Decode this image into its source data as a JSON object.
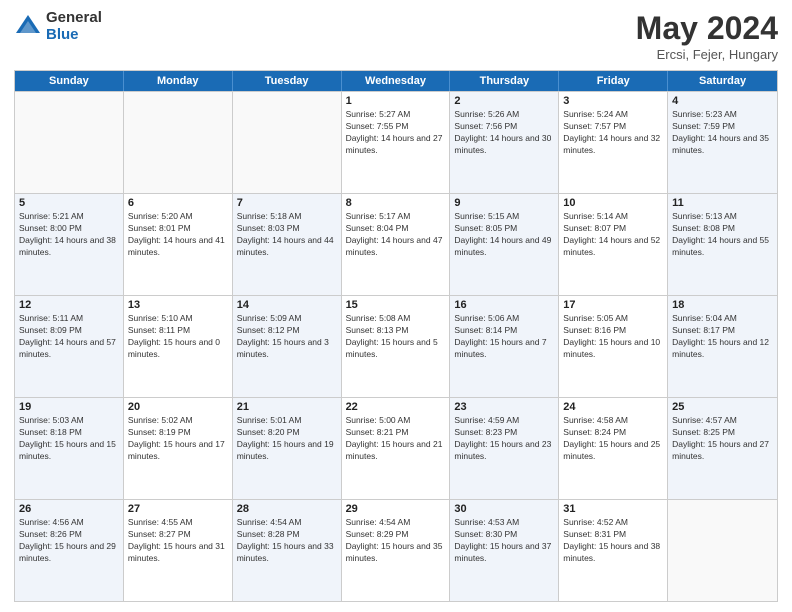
{
  "header": {
    "logo_general": "General",
    "logo_blue": "Blue",
    "title": "May 2024",
    "subtitle": "Ercsi, Fejer, Hungary"
  },
  "calendar": {
    "days_of_week": [
      "Sunday",
      "Monday",
      "Tuesday",
      "Wednesday",
      "Thursday",
      "Friday",
      "Saturday"
    ],
    "rows": [
      [
        {
          "day": "",
          "empty": true
        },
        {
          "day": "",
          "empty": true
        },
        {
          "day": "",
          "empty": true
        },
        {
          "day": "1",
          "sunrise": "5:27 AM",
          "sunset": "7:55 PM",
          "daylight": "14 hours and 27 minutes."
        },
        {
          "day": "2",
          "sunrise": "5:26 AM",
          "sunset": "7:56 PM",
          "daylight": "14 hours and 30 minutes."
        },
        {
          "day": "3",
          "sunrise": "5:24 AM",
          "sunset": "7:57 PM",
          "daylight": "14 hours and 32 minutes."
        },
        {
          "day": "4",
          "sunrise": "5:23 AM",
          "sunset": "7:59 PM",
          "daylight": "14 hours and 35 minutes."
        }
      ],
      [
        {
          "day": "5",
          "sunrise": "5:21 AM",
          "sunset": "8:00 PM",
          "daylight": "14 hours and 38 minutes."
        },
        {
          "day": "6",
          "sunrise": "5:20 AM",
          "sunset": "8:01 PM",
          "daylight": "14 hours and 41 minutes."
        },
        {
          "day": "7",
          "sunrise": "5:18 AM",
          "sunset": "8:03 PM",
          "daylight": "14 hours and 44 minutes."
        },
        {
          "day": "8",
          "sunrise": "5:17 AM",
          "sunset": "8:04 PM",
          "daylight": "14 hours and 47 minutes."
        },
        {
          "day": "9",
          "sunrise": "5:15 AM",
          "sunset": "8:05 PM",
          "daylight": "14 hours and 49 minutes."
        },
        {
          "day": "10",
          "sunrise": "5:14 AM",
          "sunset": "8:07 PM",
          "daylight": "14 hours and 52 minutes."
        },
        {
          "day": "11",
          "sunrise": "5:13 AM",
          "sunset": "8:08 PM",
          "daylight": "14 hours and 55 minutes."
        }
      ],
      [
        {
          "day": "12",
          "sunrise": "5:11 AM",
          "sunset": "8:09 PM",
          "daylight": "14 hours and 57 minutes."
        },
        {
          "day": "13",
          "sunrise": "5:10 AM",
          "sunset": "8:11 PM",
          "daylight": "15 hours and 0 minutes."
        },
        {
          "day": "14",
          "sunrise": "5:09 AM",
          "sunset": "8:12 PM",
          "daylight": "15 hours and 3 minutes."
        },
        {
          "day": "15",
          "sunrise": "5:08 AM",
          "sunset": "8:13 PM",
          "daylight": "15 hours and 5 minutes."
        },
        {
          "day": "16",
          "sunrise": "5:06 AM",
          "sunset": "8:14 PM",
          "daylight": "15 hours and 7 minutes."
        },
        {
          "day": "17",
          "sunrise": "5:05 AM",
          "sunset": "8:16 PM",
          "daylight": "15 hours and 10 minutes."
        },
        {
          "day": "18",
          "sunrise": "5:04 AM",
          "sunset": "8:17 PM",
          "daylight": "15 hours and 12 minutes."
        }
      ],
      [
        {
          "day": "19",
          "sunrise": "5:03 AM",
          "sunset": "8:18 PM",
          "daylight": "15 hours and 15 minutes."
        },
        {
          "day": "20",
          "sunrise": "5:02 AM",
          "sunset": "8:19 PM",
          "daylight": "15 hours and 17 minutes."
        },
        {
          "day": "21",
          "sunrise": "5:01 AM",
          "sunset": "8:20 PM",
          "daylight": "15 hours and 19 minutes."
        },
        {
          "day": "22",
          "sunrise": "5:00 AM",
          "sunset": "8:21 PM",
          "daylight": "15 hours and 21 minutes."
        },
        {
          "day": "23",
          "sunrise": "4:59 AM",
          "sunset": "8:23 PM",
          "daylight": "15 hours and 23 minutes."
        },
        {
          "day": "24",
          "sunrise": "4:58 AM",
          "sunset": "8:24 PM",
          "daylight": "15 hours and 25 minutes."
        },
        {
          "day": "25",
          "sunrise": "4:57 AM",
          "sunset": "8:25 PM",
          "daylight": "15 hours and 27 minutes."
        }
      ],
      [
        {
          "day": "26",
          "sunrise": "4:56 AM",
          "sunset": "8:26 PM",
          "daylight": "15 hours and 29 minutes."
        },
        {
          "day": "27",
          "sunrise": "4:55 AM",
          "sunset": "8:27 PM",
          "daylight": "15 hours and 31 minutes."
        },
        {
          "day": "28",
          "sunrise": "4:54 AM",
          "sunset": "8:28 PM",
          "daylight": "15 hours and 33 minutes."
        },
        {
          "day": "29",
          "sunrise": "4:54 AM",
          "sunset": "8:29 PM",
          "daylight": "15 hours and 35 minutes."
        },
        {
          "day": "30",
          "sunrise": "4:53 AM",
          "sunset": "8:30 PM",
          "daylight": "15 hours and 37 minutes."
        },
        {
          "day": "31",
          "sunrise": "4:52 AM",
          "sunset": "8:31 PM",
          "daylight": "15 hours and 38 minutes."
        },
        {
          "day": "",
          "empty": true
        }
      ]
    ]
  }
}
